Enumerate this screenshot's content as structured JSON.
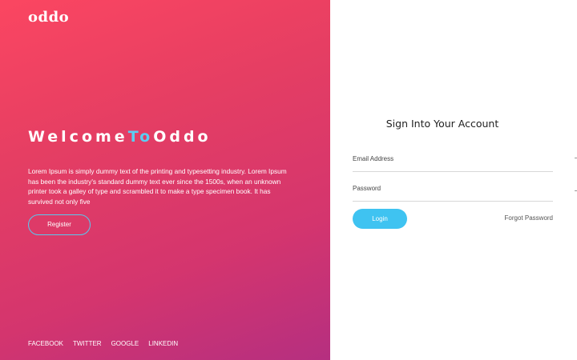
{
  "brand": {
    "name": "oddo"
  },
  "hero": {
    "welcome": "Welcome",
    "to": "To",
    "oddo": "Oddo",
    "description": "Lorem Ipsum is simply dummy text of the printing and typesetting industry. Lorem Ipsum has been the industry's standard dummy text ever since the 1500s, when an unknown printer took a galley of type and scrambled it to make a type specimen book. It has survived not only five",
    "register_label": "Register"
  },
  "social": {
    "facebook": "FACEBOOK",
    "twitter": "TWITTER",
    "google": "GOOGLE",
    "linkedin": "LINKEDIN"
  },
  "form": {
    "title": "Sign Into Your Account",
    "email_placeholder": "Email Address",
    "email_value": "",
    "password_placeholder": "Password",
    "password_value": "",
    "login_label": "Login",
    "forgot_label": "Forgot Password"
  },
  "colors": {
    "gradient_start": "#fb4661",
    "gradient_end": "#b52f80",
    "accent_blue": "#3fc3f1",
    "background_right": "#ffffff"
  }
}
